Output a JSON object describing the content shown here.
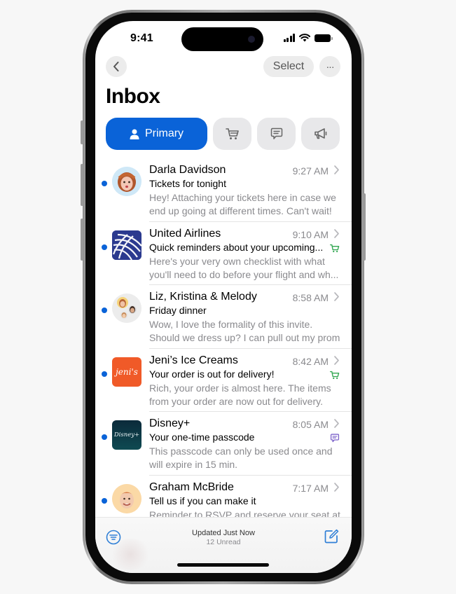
{
  "status_bar": {
    "time": "9:41"
  },
  "nav": {
    "back_icon": "chevron-left-icon",
    "select_label": "Select",
    "more_label": "···"
  },
  "header": {
    "title": "Inbox"
  },
  "tabs": [
    {
      "label": "Primary",
      "icon": "person-icon",
      "selected": true
    },
    {
      "label": "",
      "icon": "cart-icon",
      "selected": false
    },
    {
      "label": "",
      "icon": "chat-bubble-icon",
      "selected": false
    },
    {
      "label": "",
      "icon": "megaphone-icon",
      "selected": false
    }
  ],
  "messages": [
    {
      "sender": "Darla Davidson",
      "time": "9:27 AM",
      "subject": "Tickets for tonight",
      "preview": "Hey! Attaching your tickets here in case we end up going at different times. Can't wait!",
      "unread": true,
      "avatar": "memoji-darla",
      "category_icon": ""
    },
    {
      "sender": "United Airlines",
      "time": "9:10 AM",
      "subject": "Quick reminders about your upcoming...",
      "preview": "Here's your very own checklist with what you'll need to do before your flight and wh...",
      "unread": true,
      "avatar": "united-globe-logo",
      "category_icon": "cart-icon"
    },
    {
      "sender": "Liz, Kristina & Melody",
      "time": "8:58 AM",
      "subject": "Friday dinner",
      "preview": "Wow, I love the formality of this invite. Should we dress up? I can pull out my prom dress...",
      "unread": true,
      "avatar": "group-memoji",
      "category_icon": ""
    },
    {
      "sender": "Jeni’s Ice Creams",
      "time": "8:42 AM",
      "subject": "Your order is out for delivery!",
      "preview": "Rich, your order is almost here. The items from your order are now out for delivery.",
      "unread": true,
      "avatar": "jenis-logo",
      "avatar_text": "jeni's",
      "category_icon": "cart-icon"
    },
    {
      "sender": "Disney+",
      "time": "8:05 AM",
      "subject": "Your one-time passcode",
      "preview": "This passcode can only be used once and will expire in 15 min.",
      "unread": true,
      "avatar": "disney-plus-logo",
      "avatar_text": "Disney+",
      "category_icon": "chat-bubble-icon"
    },
    {
      "sender": "Graham McBride",
      "time": "7:17 AM",
      "subject": "Tell us if you can make it",
      "preview": "Reminder to RSVP and reserve your seat at",
      "unread": true,
      "avatar": "memoji-graham",
      "category_icon": ""
    }
  ],
  "toolbar": {
    "status_line": "Updated Just Now",
    "unread_count": "12 Unread",
    "filter_icon": "filter-icon",
    "compose_icon": "compose-icon"
  },
  "colors": {
    "accent": "#0a63d8",
    "shopping_badge": "#34a853",
    "updates_badge": "#7b61c9",
    "jenis_brand": "#f05a28",
    "united_brand": "#2b3a8f",
    "disney_brand": "#0e3a45"
  }
}
